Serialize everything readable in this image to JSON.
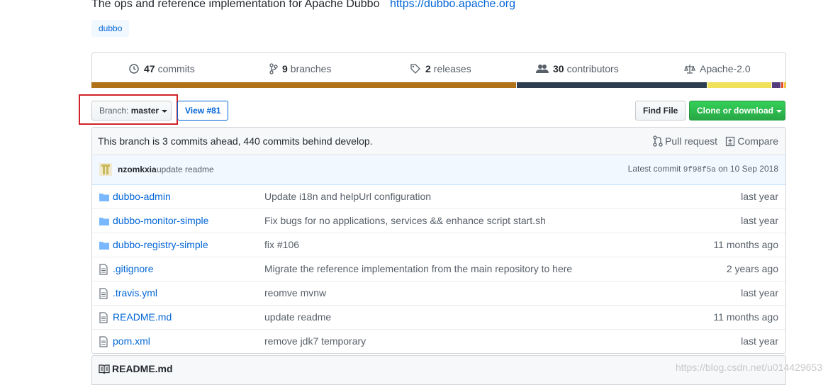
{
  "repo": {
    "description": "The ops and reference implementation for Apache Dubbo",
    "url": "https://dubbo.apache.org",
    "topic": "dubbo"
  },
  "summary": {
    "commits": {
      "count": "47",
      "label": "commits",
      "icon": "history-icon"
    },
    "branches": {
      "count": "9",
      "label": "branches",
      "icon": "git-branch-icon"
    },
    "releases": {
      "count": "2",
      "label": "releases",
      "icon": "tag-icon"
    },
    "contributors": {
      "count": "30",
      "label": "contributors",
      "icon": "people-icon"
    },
    "license": {
      "label": "Apache-2.0",
      "icon": "law-icon"
    }
  },
  "language_bar": [
    {
      "color": "#b07219",
      "percent": 61.4
    },
    {
      "color": "#2c3e50",
      "percent": 27.5
    },
    {
      "color": "#f1e05a",
      "percent": 9.3
    },
    {
      "color": "#563d7c",
      "percent": 1.2
    },
    {
      "color": "#e34c26",
      "percent": 0.3
    },
    {
      "color": "#f4c542",
      "percent": 0.3
    }
  ],
  "toolbar": {
    "branch_prefix": "Branch:",
    "branch_name": "master",
    "view_pr": "View #81",
    "find_file": "Find File",
    "clone": "Clone or download"
  },
  "branch_status": {
    "text": "This branch is 3 commits ahead, 440 commits behind develop.",
    "pull_request": "Pull request",
    "compare": "Compare"
  },
  "latest_commit": {
    "author": "nzomkxia",
    "message": "update readme",
    "prefix": "Latest commit",
    "sha": "9f98f5a",
    "date": "on 10 Sep 2018"
  },
  "files": [
    {
      "type": "dir",
      "name": "dubbo-admin",
      "message": "Update i18n and helpUrl configuration",
      "age": "last year"
    },
    {
      "type": "dir",
      "name": "dubbo-monitor-simple",
      "message": "Fix bugs for no applications, services && enhance script start.sh",
      "age": "last year"
    },
    {
      "type": "dir",
      "name": "dubbo-registry-simple",
      "message": "fix #106",
      "age": "11 months ago"
    },
    {
      "type": "file",
      "name": ".gitignore",
      "message": "Migrate the reference implementation from the main repository to here",
      "age": "2 years ago"
    },
    {
      "type": "file",
      "name": ".travis.yml",
      "message": "reomve mvnw",
      "age": "last year"
    },
    {
      "type": "file",
      "name": "README.md",
      "message": "update readme",
      "age": "11 months ago"
    },
    {
      "type": "file",
      "name": "pom.xml",
      "message": "remove jdk7 temporary",
      "age": "last year"
    }
  ],
  "readme": {
    "title": "README.md"
  },
  "watermark": "https://blog.csdn.net/u014429653",
  "colors": {
    "link": "#0366d6",
    "green_button": "#28a745",
    "highlight_box": "#d0232a"
  }
}
